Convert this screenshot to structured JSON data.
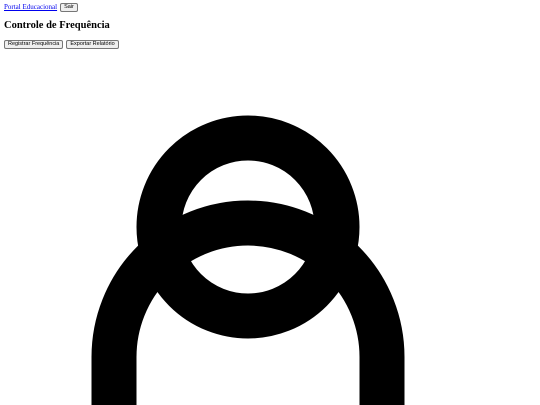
{
  "nav": {
    "portal_link": "Portal Educacional",
    "logout_label": "Sair"
  },
  "page": {
    "title": "Controle de Frequência"
  },
  "actions": {
    "register_label": "Registrar Frequência",
    "export_label": "Exportar Relatório"
  },
  "icons": {
    "large_graphic": "user-icon"
  }
}
